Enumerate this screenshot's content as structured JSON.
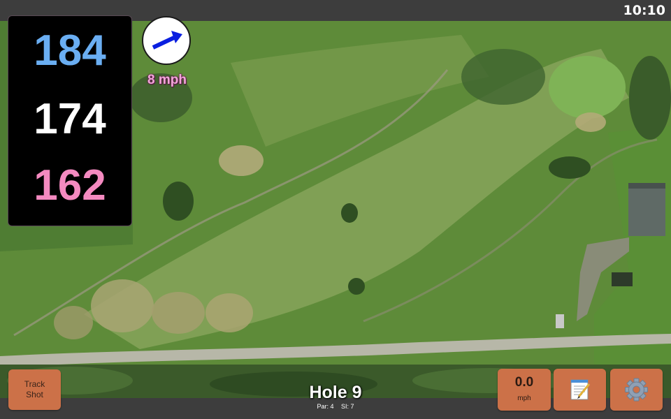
{
  "status_bar": {
    "time": "10:10"
  },
  "yardages": {
    "back": "184",
    "middle": "174",
    "front": "162"
  },
  "wind": {
    "speed": "8 mph",
    "direction_icon": "arrow-right-icon"
  },
  "hole": {
    "title": "Hole 9",
    "par": "Par: 4",
    "stroke_index": "SI: 7"
  },
  "buttons": {
    "track_shot": "Track\nShot",
    "speed_value": "0.0",
    "speed_unit": "mph",
    "notes_icon": "notepad-icon",
    "settings_icon": "gear-icon"
  },
  "colors": {
    "back_yardage": "#6aaef2",
    "mid_yardage": "#ffffff",
    "front_yardage": "#f48ac0",
    "button_bg": "#cc7148",
    "wind_arrow": "#0a1fe0",
    "wind_text": "#f2a6d9"
  }
}
